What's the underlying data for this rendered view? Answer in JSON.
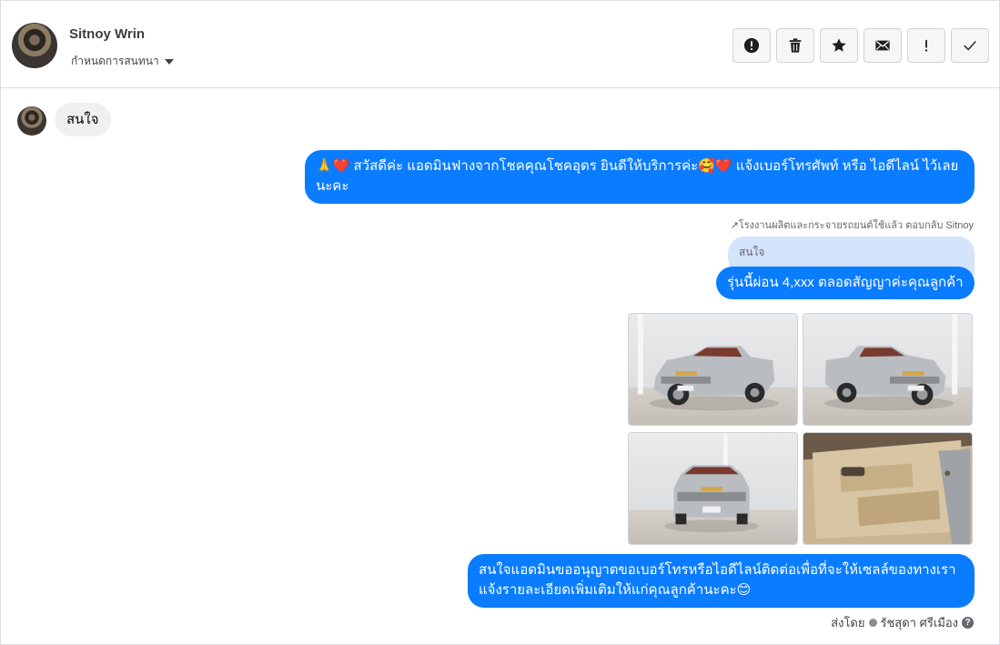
{
  "header": {
    "contact_name": "Sitnoy Wrin",
    "assign_label": "กำหนดการสนทนา"
  },
  "toolbar": {
    "buttons": [
      {
        "icon": "alert-circle-icon",
        "label": "spam"
      },
      {
        "icon": "trash-icon",
        "label": "delete"
      },
      {
        "icon": "star-icon",
        "label": "star"
      },
      {
        "icon": "envelope-icon",
        "label": "mark-unread"
      },
      {
        "icon": "exclamation-icon",
        "label": "follow-up"
      },
      {
        "icon": "check-icon",
        "label": "done"
      }
    ]
  },
  "messages": {
    "incoming_1": "สนใจ",
    "outgoing_1": "🙏❤️ สวัสดีค่ะ แอดมินฟางจากโชคคุณโชคอุดร ยินดีให้บริการค่ะ🥰❤️ แจ้งเบอร์โทรศัพท์ หรือ ไอดีไลน์  ไว้เลยนะคะ",
    "reply_note": "↗โรงงานผลิตและกระจายรถยนต์ใช้แล้ว ตอบกลับ Sitnoy",
    "quoted_text": "สนใจ",
    "outgoing_2": "รุ่นนี้ผ่อน 4,xxx ตลอดสัญญาค่ะคุณลูกค้า",
    "outgoing_3": "สนใจแอดมินขออนุญาตขอเบอร์โทรหรือไอดีไลน์ติดต่อเพื่อที่จะให้เซลล์ของทางเราแจ้งรายละเอียดเพิ่มเติมให้แก่คุณลูกค้านะคะ😊"
  },
  "photos": [
    {
      "subject": "pickup-front-left"
    },
    {
      "subject": "pickup-front-right"
    },
    {
      "subject": "pickup-front"
    },
    {
      "subject": "door-interior"
    }
  ],
  "footer": {
    "sent_by_prefix": "ส่งโดย",
    "sender_name": "รัชสุดา ศรีเมือง",
    "help_glyph": "?"
  },
  "colors": {
    "outgoing_bubble": "#0a7cff",
    "incoming_bubble": "#f0f0f0",
    "quoted_bubble": "#d4e4fb"
  }
}
